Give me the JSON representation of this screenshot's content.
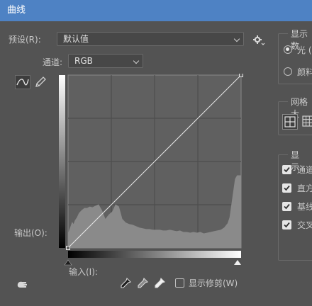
{
  "window": {
    "title": "曲线"
  },
  "preset": {
    "label": "预设(R):",
    "value": "默认值"
  },
  "channel": {
    "label": "通道:",
    "value": "RGB"
  },
  "curve_area": {
    "output_label": "输出(O):",
    "input_label": "输入(I):",
    "show_clipping_label": "显示修剪(W)"
  },
  "display_amount": {
    "title": "显示数",
    "options": [
      {
        "label": "光 (",
        "selected": true
      },
      {
        "label": "颜料",
        "selected": false
      }
    ]
  },
  "grid_size": {
    "title": "网格大"
  },
  "show": {
    "title": "显示:",
    "items": [
      {
        "label": "通道",
        "checked": true
      },
      {
        "label": "直方",
        "checked": true
      },
      {
        "label": "基线",
        "checked": true
      },
      {
        "label": "交叉",
        "checked": true
      }
    ]
  },
  "icons": {
    "curve_tool": "curve-point-icon",
    "pencil_tool": "pencil-icon",
    "settings": "gear-icon",
    "auto_adjust": "hand-icon",
    "eyedropper_black": "eyedropper-icon",
    "eyedropper_gray": "eyedropper-icon",
    "eyedropper_white": "eyedropper-icon",
    "grid_simple": "grid-4-icon",
    "grid_detailed": "grid-10-icon"
  },
  "chart_data": {
    "type": "area",
    "x": [
      0,
      3,
      6,
      8,
      10,
      13,
      16,
      20,
      24,
      28,
      32,
      36,
      40,
      45,
      50,
      55,
      60,
      65,
      70,
      75,
      80,
      85,
      90,
      95,
      100,
      105,
      110,
      115,
      120,
      125,
      130,
      135,
      140,
      145,
      150,
      155,
      160,
      165,
      170,
      175,
      180,
      185,
      190,
      195,
      200,
      205,
      210,
      215,
      220,
      225,
      230,
      235,
      238,
      240,
      243,
      246,
      249,
      252,
      255
    ],
    "values": [
      20,
      28,
      36,
      33,
      38,
      42,
      48,
      52,
      55,
      55,
      57,
      56,
      58,
      60,
      52,
      40,
      46,
      50,
      60,
      57,
      40,
      35,
      33,
      32,
      30,
      28,
      27,
      26,
      26,
      25,
      25,
      25,
      24,
      24,
      25,
      24,
      23,
      24,
      22,
      22,
      21,
      22,
      21,
      22,
      20,
      21,
      22,
      23,
      24,
      25,
      28,
      34,
      42,
      55,
      75,
      95,
      100,
      100,
      100
    ],
    "baseline": [
      [
        0,
        0
      ],
      [
        255,
        255
      ]
    ],
    "xlim": [
      0,
      255
    ],
    "ylim": [
      0,
      255
    ]
  }
}
